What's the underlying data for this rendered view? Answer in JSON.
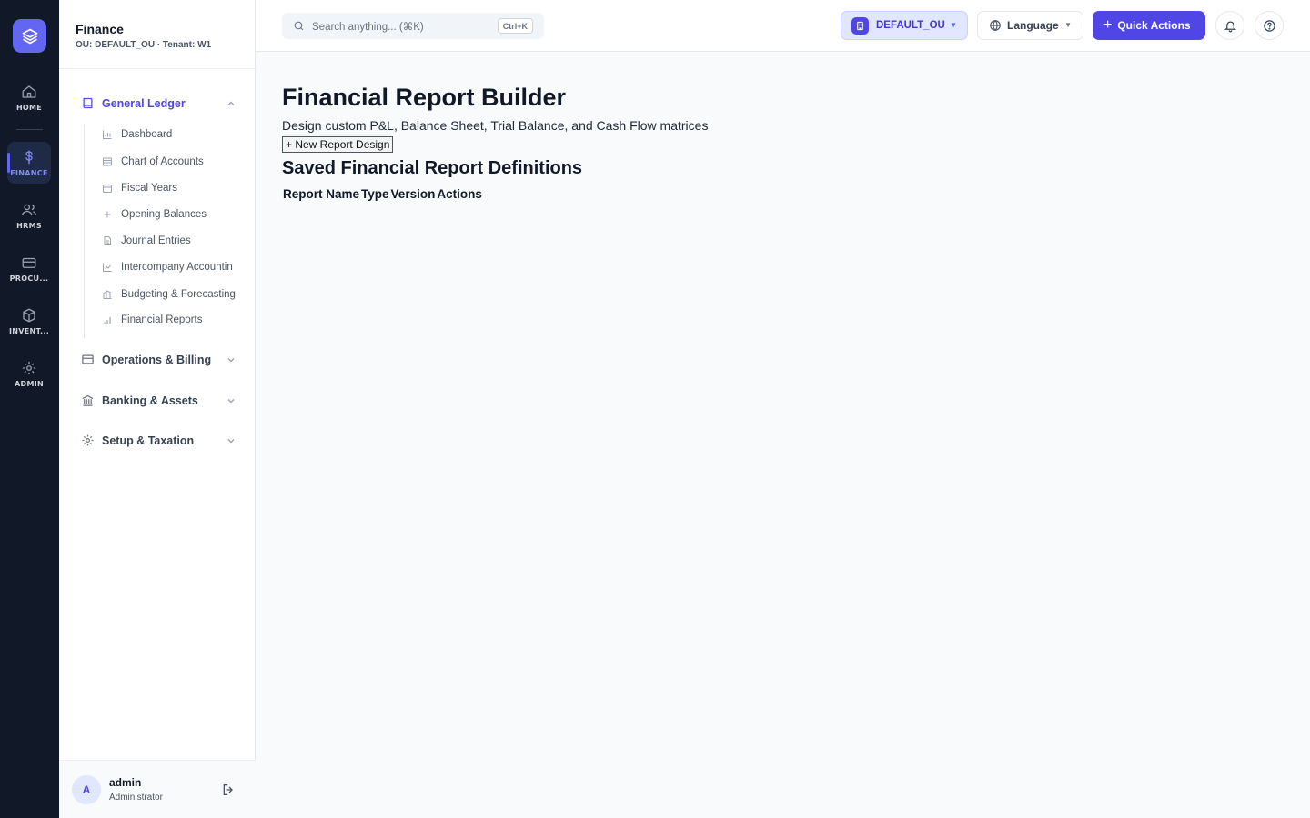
{
  "rail": {
    "items": [
      {
        "label": "HOME",
        "icon": "home-icon"
      },
      {
        "label": "FINANCE",
        "icon": "dollar-icon",
        "active": true
      },
      {
        "label": "HRMS",
        "icon": "users-icon"
      },
      {
        "label": "PROCU...",
        "icon": "card-icon"
      },
      {
        "label": "INVENT...",
        "icon": "box-icon"
      },
      {
        "label": "ADMIN",
        "icon": "gear-icon"
      }
    ]
  },
  "sidebar": {
    "title": "Finance",
    "subtitle": "OU: DEFAULT_OU · Tenant: W1",
    "groups": [
      {
        "label": "General Ledger",
        "icon": "book-icon",
        "expanded": true
      },
      {
        "label": "Operations & Billing",
        "icon": "billing-card-icon"
      },
      {
        "label": "Banking & Assets",
        "icon": "bank-icon"
      },
      {
        "label": "Setup & Taxation",
        "icon": "settings-icon"
      }
    ],
    "ledger_items": [
      {
        "label": "Dashboard",
        "icon": "bar-chart-icon"
      },
      {
        "label": "Chart of Accounts",
        "icon": "table-icon"
      },
      {
        "label": "Fiscal Years",
        "icon": "calendar-icon"
      },
      {
        "label": "Opening Balances",
        "icon": "plus-icon"
      },
      {
        "label": "Journal Entries",
        "icon": "document-icon"
      },
      {
        "label": "Intercompany Accountin",
        "icon": "trend-icon"
      },
      {
        "label": "Budgeting & Forecasting",
        "icon": "buildings-icon"
      },
      {
        "label": "Financial Reports",
        "icon": "signal-icon"
      }
    ],
    "user": {
      "initial": "A",
      "name": "admin",
      "role": "Administrator"
    }
  },
  "topbar": {
    "search_placeholder": "Search anything... (⌘K)",
    "shortcut": "Ctrl+K",
    "ou": "DEFAULT_OU",
    "language": "Language",
    "quick_actions": "Quick Actions"
  },
  "main": {
    "title": "Financial Report Builder",
    "description": "Design custom P&L, Balance Sheet, Trial Balance, and Cash Flow matrices",
    "new_button": "+ New Report Design",
    "section_title": "Saved Financial Report Definitions",
    "columns": [
      "Report Name",
      "Type",
      "Version",
      "Actions"
    ]
  },
  "colors": {
    "rail_bg": "#111827",
    "accent": "#4f46e5",
    "page_bg": "#f8fafc"
  }
}
